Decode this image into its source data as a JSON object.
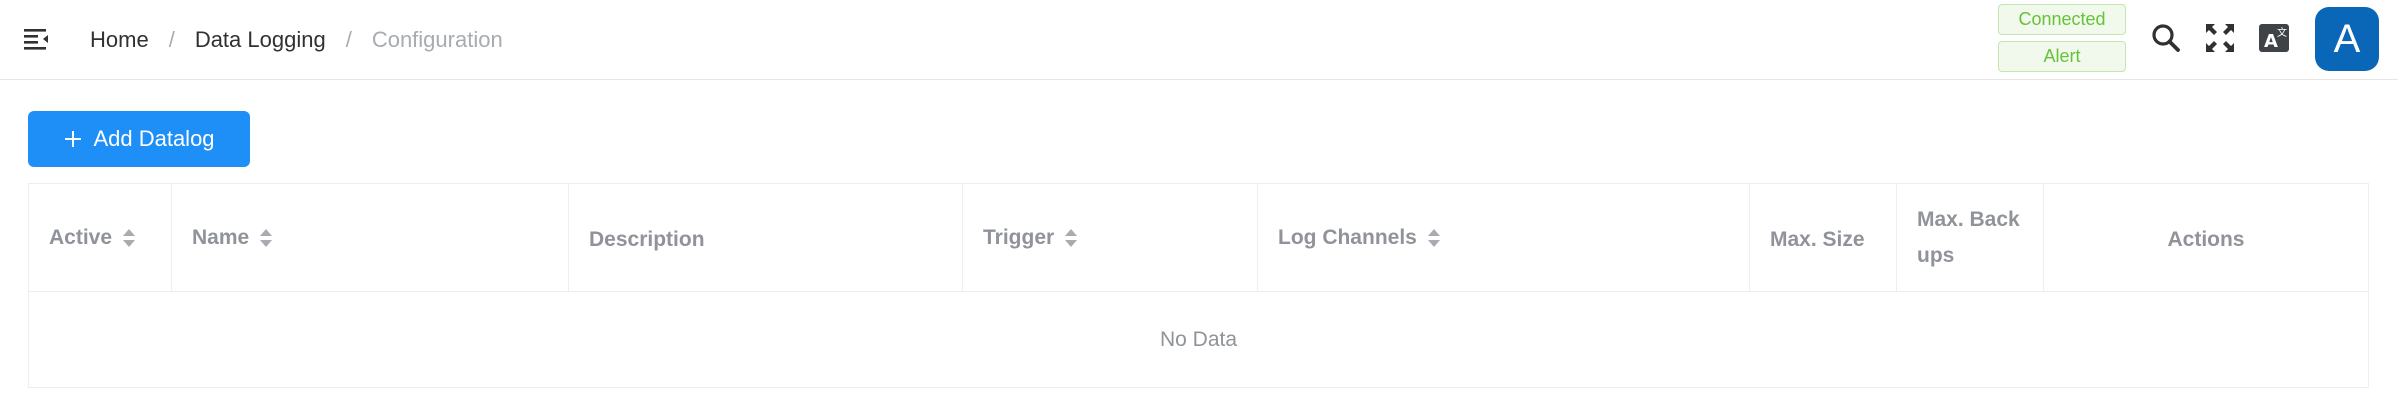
{
  "breadcrumb": {
    "home": "Home",
    "section": "Data Logging",
    "current": "Configuration",
    "separator": "/"
  },
  "status": {
    "connected": "Connected",
    "alert": "Alert",
    "color": "#67c23a"
  },
  "header_icons": [
    "menu-fold-icon",
    "search-icon",
    "fullscreen-icon",
    "translate-icon"
  ],
  "avatar": {
    "initial": "A",
    "color": "#0a67b7"
  },
  "toolbar": {
    "add_label": "Add Datalog",
    "accent": "#1f8ff8"
  },
  "table": {
    "columns": [
      {
        "label": "Active",
        "sortable": true
      },
      {
        "label": "Name",
        "sortable": true
      },
      {
        "label": "Description",
        "sortable": false
      },
      {
        "label": "Trigger",
        "sortable": true
      },
      {
        "label": "Log Channels",
        "sortable": true
      },
      {
        "label": "Max. Size",
        "sortable": false
      },
      {
        "label": "Max. Back ups",
        "sortable": false
      },
      {
        "label": "Actions",
        "sortable": false
      }
    ],
    "rows": [],
    "empty_text": "No Data"
  }
}
